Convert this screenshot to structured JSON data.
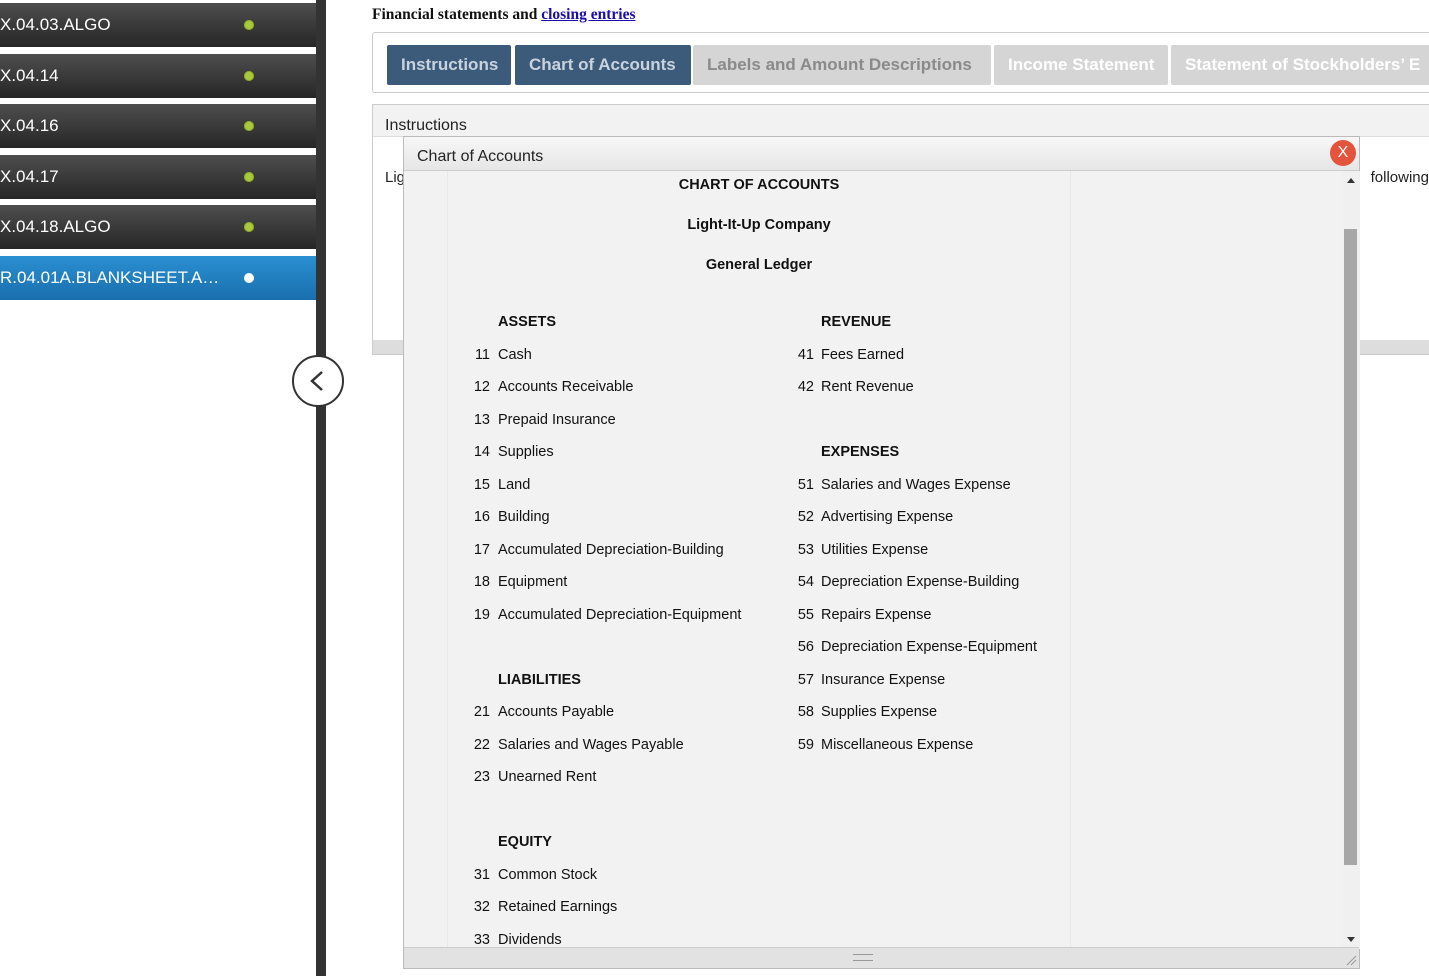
{
  "sidebar": {
    "items": [
      {
        "label": "X.04.03.ALGO",
        "status": "complete"
      },
      {
        "label": "X.04.14",
        "status": "complete"
      },
      {
        "label": "X.04.16",
        "status": "complete"
      },
      {
        "label": "X.04.17",
        "status": "complete"
      },
      {
        "label": "X.04.18.ALGO",
        "status": "complete"
      },
      {
        "label": "R.04.01A.BLANKSHEET.A…",
        "status": "current"
      }
    ]
  },
  "header": {
    "title_prefix": "Financial statements and ",
    "title_link": "closing entries"
  },
  "tabs": [
    {
      "label": "Instructions"
    },
    {
      "label": "Chart of Accounts"
    },
    {
      "label": "Labels and Amount Descriptions"
    },
    {
      "label": "Income Statement"
    },
    {
      "label": "Statement of Stockholders’ E"
    }
  ],
  "instructions_panel": {
    "title": "Instructions",
    "text_left": "Lig",
    "text_right": "following"
  },
  "modal": {
    "title": "Chart of Accounts",
    "close_label": "X",
    "heading": "CHART OF ACCOUNTS",
    "company": "Light-It-Up Company",
    "ledger": "General Ledger",
    "left_sections": [
      {
        "title": "ASSETS",
        "accounts": [
          {
            "no": "11",
            "name": "Cash"
          },
          {
            "no": "12",
            "name": "Accounts Receivable"
          },
          {
            "no": "13",
            "name": "Prepaid Insurance"
          },
          {
            "no": "14",
            "name": "Supplies"
          },
          {
            "no": "15",
            "name": "Land"
          },
          {
            "no": "16",
            "name": "Building"
          },
          {
            "no": "17",
            "name": "Accumulated Depreciation-Building"
          },
          {
            "no": "18",
            "name": "Equipment"
          },
          {
            "no": "19",
            "name": "Accumulated Depreciation-Equipment"
          }
        ]
      },
      {
        "title": "LIABILITIES",
        "accounts": [
          {
            "no": "21",
            "name": "Accounts Payable"
          },
          {
            "no": "22",
            "name": "Salaries and Wages Payable"
          },
          {
            "no": "23",
            "name": "Unearned Rent"
          }
        ]
      },
      {
        "title": "EQUITY",
        "accounts": [
          {
            "no": "31",
            "name": "Common Stock"
          },
          {
            "no": "32",
            "name": "Retained Earnings"
          },
          {
            "no": "33",
            "name": "Dividends"
          }
        ]
      }
    ],
    "right_sections": [
      {
        "title": "REVENUE",
        "accounts": [
          {
            "no": "41",
            "name": "Fees Earned"
          },
          {
            "no": "42",
            "name": "Rent Revenue"
          }
        ]
      },
      {
        "title": "EXPENSES",
        "accounts": [
          {
            "no": "51",
            "name": "Salaries and Wages Expense"
          },
          {
            "no": "52",
            "name": "Advertising Expense"
          },
          {
            "no": "53",
            "name": "Utilities Expense"
          },
          {
            "no": "54",
            "name": "Depreciation Expense-Building"
          },
          {
            "no": "55",
            "name": "Repairs Expense"
          },
          {
            "no": "56",
            "name": "Depreciation Expense-Equipment"
          },
          {
            "no": "57",
            "name": "Insurance Expense"
          },
          {
            "no": "58",
            "name": "Supplies Expense"
          },
          {
            "no": "59",
            "name": "Miscellaneous Expense"
          }
        ]
      }
    ]
  },
  "colors": {
    "sidebar_active": "#1f7fc2",
    "tab_dark": "#3c5a7a",
    "tab_light": "#d5d5d5",
    "close_button": "#e4533b",
    "check": "#a9c93d"
  }
}
